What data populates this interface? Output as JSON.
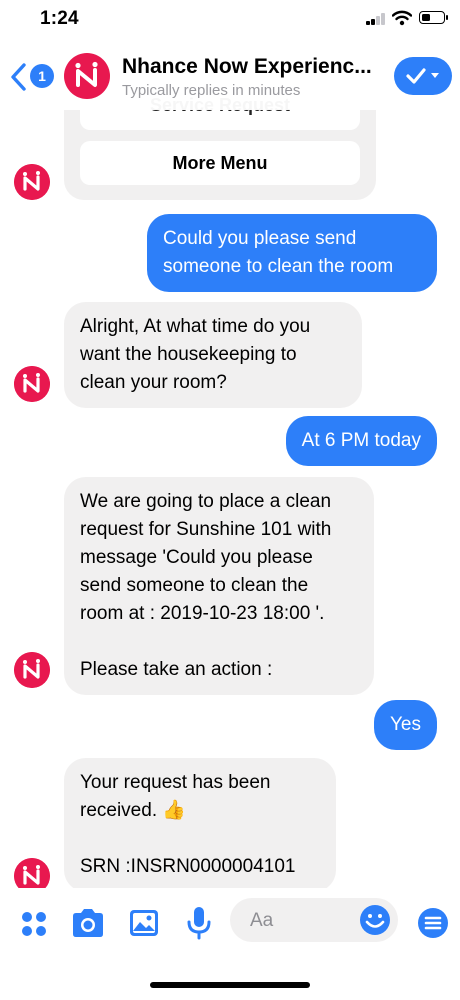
{
  "status_bar": {
    "time": "1:24"
  },
  "header": {
    "back_badge": "1",
    "title": "Nhance Now Experienc...",
    "subtitle": "Typically replies in minutes"
  },
  "card": {
    "partial_button_label": "Service Request",
    "more_menu_label": "More Menu"
  },
  "messages": [
    {
      "from": "user",
      "text": "Could you please send\nsomeone to clean the room"
    },
    {
      "from": "bot",
      "text": "Alright,  At what time do you\nwant the housekeeping to\nclean your room?"
    },
    {
      "from": "user",
      "text": "At 6 PM today"
    },
    {
      "from": "bot",
      "text": "We are going to place a clean\nrequest for Sunshine 101 with\nmessage 'Could you please\nsend someone to clean the\nroom at : 2019-10-23 18:00 '.\n\n Please take an action :"
    },
    {
      "from": "user",
      "text": "Yes"
    },
    {
      "from": "bot",
      "text": "Your request has been\nreceived. 👍\n\n SRN :INSRN0000004101"
    }
  ],
  "composer": {
    "placeholder": "Aa"
  },
  "colors": {
    "accent": "#2d7ff9",
    "brand": "#e8184f",
    "bubble_gray": "#f1f0f0"
  }
}
